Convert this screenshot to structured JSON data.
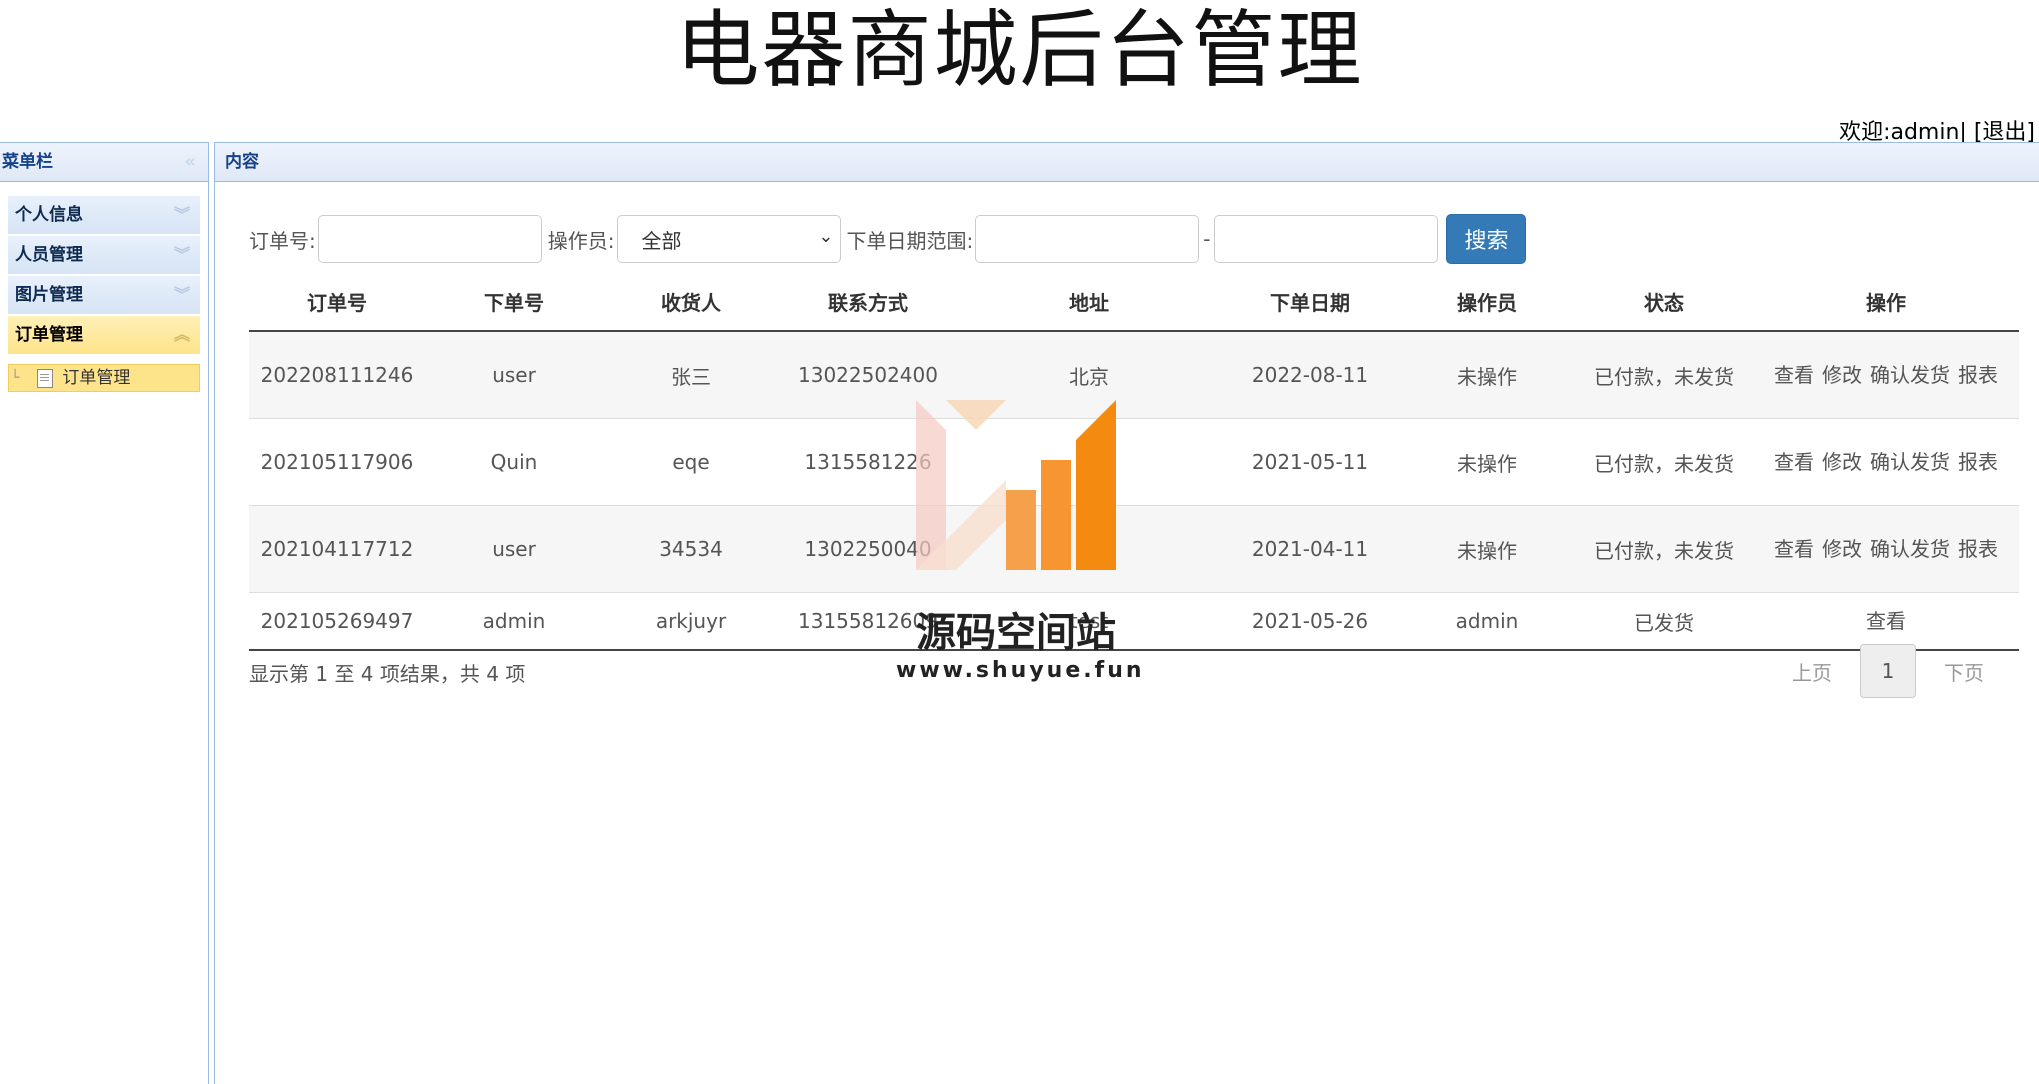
{
  "header": {
    "title": "电器商城后台管理",
    "welcome": "欢迎:admin|",
    "logout": "[退出]"
  },
  "sidebar": {
    "title": "菜单栏",
    "items": [
      {
        "label": "个人信息"
      },
      {
        "label": "人员管理"
      },
      {
        "label": "图片管理"
      },
      {
        "label": "订单管理"
      }
    ],
    "sub_item": "订单管理"
  },
  "content": {
    "title": "内容",
    "filters": {
      "order_label": "订单号:",
      "operator_label": "操作员:",
      "operator_value": "全部",
      "date_label": "下单日期范围:",
      "dash": "-",
      "search": "搜索"
    },
    "columns": [
      "订单号",
      "下单号",
      "收货人",
      "联系方式",
      "地址",
      "下单日期",
      "操作员",
      "状态",
      "操作"
    ],
    "rows": [
      {
        "order": "202208111246",
        "user": "user",
        "receiver": "张三",
        "phone": "13022502400",
        "address": "北京",
        "date": "2022-08-11",
        "operator": "未操作",
        "status": "已付款，未发货",
        "actions": [
          "查看",
          "修改",
          "确认发货",
          "报表"
        ]
      },
      {
        "order": "202105117906",
        "user": "Quin",
        "receiver": "eqe",
        "phone": "1315581226",
        "address": "sf",
        "date": "2021-05-11",
        "operator": "未操作",
        "status": "已付款，未发货",
        "actions": [
          "查看",
          "修改",
          "确认发货",
          "报表"
        ]
      },
      {
        "order": "202104117712",
        "user": "user",
        "receiver": "34534",
        "phone": "1302250040",
        "address": "35",
        "date": "2021-04-11",
        "operator": "未操作",
        "status": "已付款，未发货",
        "actions": [
          "查看",
          "修改",
          "确认发货",
          "报表"
        ]
      },
      {
        "order": "202105269497",
        "user": "admin",
        "receiver": "arkjuyr",
        "phone": "13155812609",
        "address": "test",
        "date": "2021-05-26",
        "operator": "admin",
        "status": "已发货",
        "actions": [
          "查看"
        ]
      }
    ],
    "summary": "显示第 1 至 4 项结果，共 4 项",
    "pager": {
      "prev": "上页",
      "current": "1",
      "next": "下页"
    }
  },
  "watermark": {
    "name": "源码空间站",
    "url": "www.shuyue.fun"
  }
}
